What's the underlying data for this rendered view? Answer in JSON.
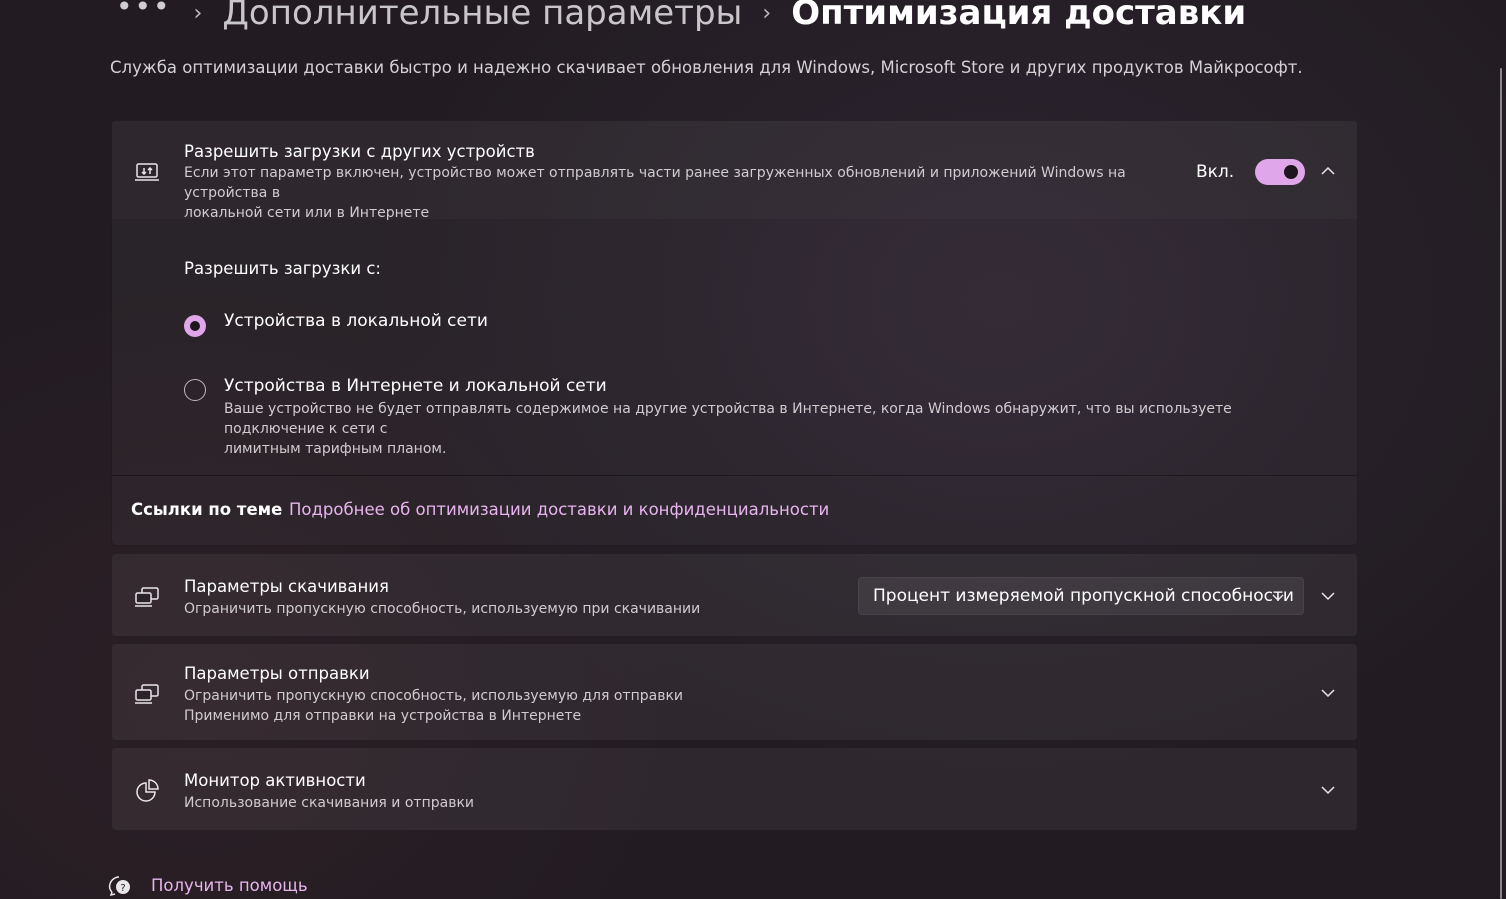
{
  "breadcrumb": {
    "more": "•••",
    "separator": "›",
    "parent": "Дополнительные параметры",
    "current": "Оптимизация доставки"
  },
  "description": "Служба оптимизации доставки быстро и надежно скачивает обновления для Windows, Microsoft Store и других продуктов Майкрософт.",
  "allow_downloads": {
    "icon": "pc-sync-icon",
    "title": "Разрешить загрузки с других устройств",
    "subtitle_line1": "Если этот параметр включен, устройство может отправлять части ранее загруженных обновлений и приложений Windows на устройства в",
    "subtitle_line2": "локальной сети или в Интернете",
    "toggle_state": "Вкл.",
    "toggle_on": true,
    "expanded": true,
    "group_label": "Разрешить загрузки с:",
    "options": [
      {
        "label": "Устройства в локальной сети",
        "selected": true
      },
      {
        "label": "Устройства в Интернете и локальной сети",
        "selected": false,
        "sub_line1": "Ваше устройство не будет отправлять содержимое на другие устройства в Интернете, когда Windows обнаружит, что вы используете подключение к сети с",
        "sub_line2": "лимитным тарифным планом."
      }
    ],
    "related_heading": "Ссылки по теме",
    "related_link": "Подробнее об оптимизации доставки и конфиденциальности"
  },
  "download_settings": {
    "icon": "devices-icon",
    "title": "Параметры скачивания",
    "subtitle": "Ограничить пропускную способность, используемую при скачивании",
    "dropdown_value": "Процент измеряемой пропускной способности"
  },
  "upload_settings": {
    "icon": "devices-icon",
    "title": "Параметры отправки",
    "subtitle_line1": "Ограничить пропускную способность, используемую для отправки",
    "subtitle_line2": "Применимо для отправки на устройства в Интернете"
  },
  "activity_monitor": {
    "icon": "pie-chart-icon",
    "title": "Монитор активности",
    "subtitle": "Использование скачивания и отправки"
  },
  "help": {
    "icon": "help-chat-icon",
    "label": "Получить помощь"
  },
  "colors": {
    "accent": "#e0a6ea",
    "link": "#e7b5ee",
    "background": "#221c22"
  }
}
